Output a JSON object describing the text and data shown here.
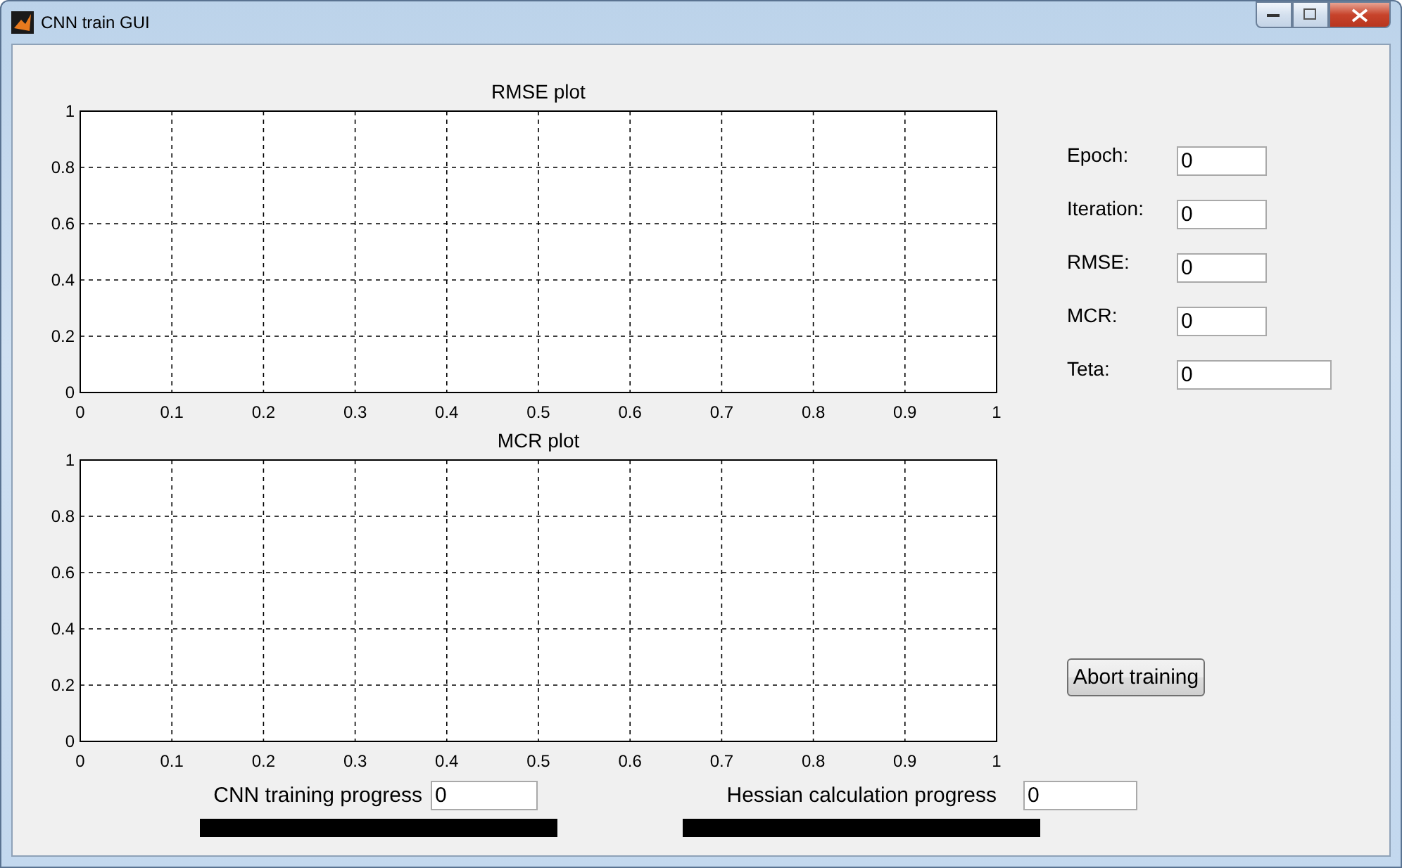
{
  "window": {
    "title": "CNN train GUI"
  },
  "plots": [
    {
      "chart_data": {
        "type": "line",
        "grid": true,
        "title": "RMSE plot",
        "xlim": [
          0,
          1
        ],
        "ylim": [
          0,
          1
        ],
        "xticks": [
          0,
          0.1,
          0.2,
          0.3,
          0.4,
          0.5,
          0.6,
          0.7,
          0.8,
          0.9,
          1
        ],
        "yticks": [
          0,
          0.2,
          0.4,
          0.6,
          0.8,
          1
        ]
      }
    },
    {
      "chart_data": {
        "type": "line",
        "grid": true,
        "title": "MCR plot",
        "xlim": [
          0,
          1
        ],
        "ylim": [
          0,
          1
        ],
        "xticks": [
          0,
          0.1,
          0.2,
          0.3,
          0.4,
          0.5,
          0.6,
          0.7,
          0.8,
          0.9,
          1
        ],
        "yticks": [
          0,
          0.2,
          0.4,
          0.6,
          0.8,
          1
        ]
      }
    }
  ],
  "stats": [
    {
      "label": "Epoch:",
      "value": "0",
      "wide": false
    },
    {
      "label": "Iteration:",
      "value": "0",
      "wide": false
    },
    {
      "label": "RMSE:",
      "value": "0",
      "wide": false
    },
    {
      "label": "MCR:",
      "value": "0",
      "wide": false
    },
    {
      "label": "Teta:",
      "value": "0",
      "wide": true
    }
  ],
  "abort_button": "Abort training",
  "progress": [
    {
      "label": "CNN training progress",
      "value": "0",
      "level": 1
    },
    {
      "label": "Hessian calculation progress",
      "value": "0",
      "level": 1
    }
  ]
}
